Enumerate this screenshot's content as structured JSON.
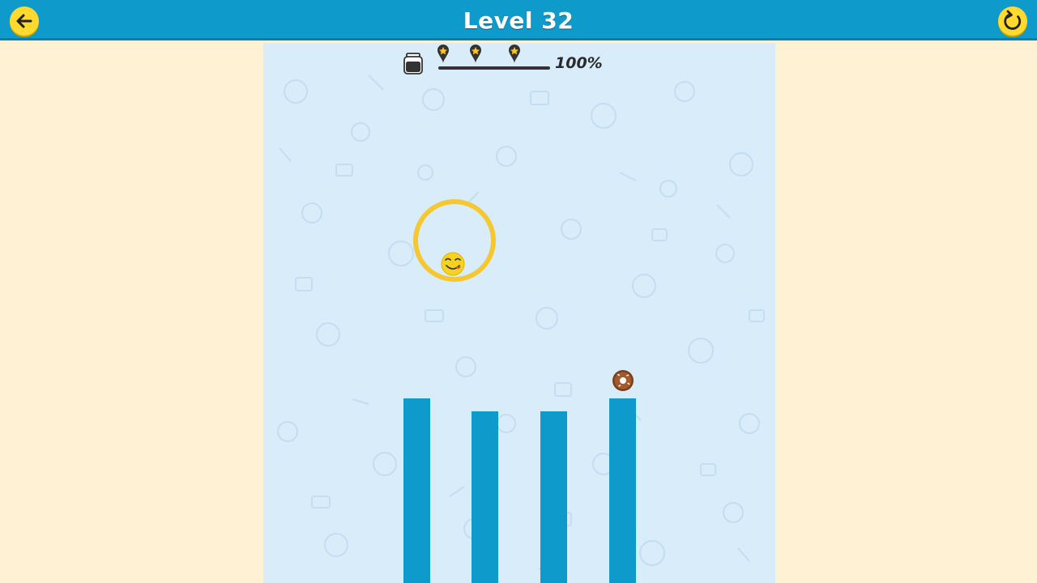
{
  "header": {
    "title": "Level 32",
    "back_icon": "arrow-left-icon",
    "restart_icon": "restart-icon"
  },
  "hud": {
    "ink_icon": "ink-jar-icon",
    "progress_percent_label": "100%",
    "progress_fraction": 1.0,
    "star_markers": 3,
    "star_icon": "star-pin-icon"
  },
  "game": {
    "drawn_shape": "circle",
    "character_icon": "smiley-face-icon",
    "goal_item_icon": "donut-icon",
    "pillar_count": 4
  },
  "colors": {
    "header_bg": "#0e9acb",
    "page_bg": "#fff1d4",
    "playfield_bg": "#d8ecfa",
    "pillar": "#0e9acb",
    "button_yellow": "#ffd92e",
    "ring_yellow": "#f5c730"
  }
}
